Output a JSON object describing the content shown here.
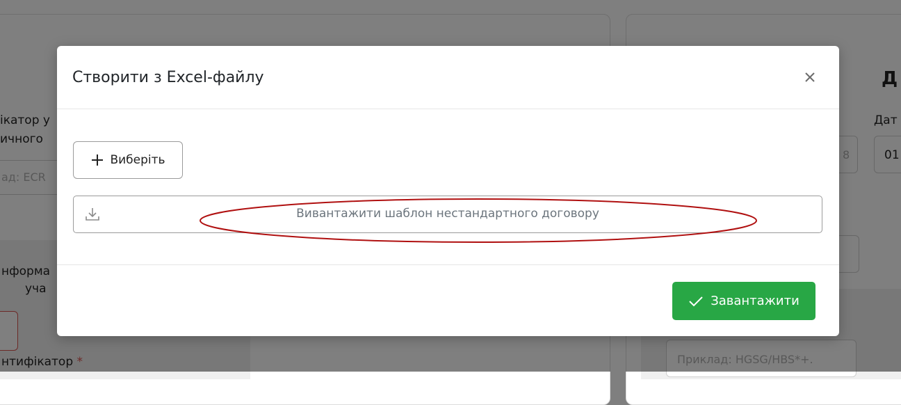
{
  "background": {
    "left_label_line1": "ікатор у",
    "left_label_line2": "ичного",
    "left_placeholder": "ад: ECR",
    "left_info_line1": "нформа",
    "left_info_line2": "уча",
    "left_identifier_label": "нтифікатор",
    "required_mark": "*",
    "right_heading_fragment": "Д",
    "right_date_label": "Дат",
    "right_field_fragment_a": "8",
    "right_field_fragment_b": "01",
    "right_placeholder": "Приклад: HGSG/HBS*+."
  },
  "modal": {
    "title": "Створити з Excel-файлу",
    "close_icon": "close-icon",
    "choose_button_label": "Виберіть",
    "choose_icon": "plus-icon",
    "download_label": "Вивантажити шаблон нестандартного договору",
    "download_icon": "download-icon",
    "upload_button_label": "Завантажити",
    "upload_icon": "check-icon",
    "accent_color": "#28a745",
    "annotation_color": "#b01010"
  }
}
